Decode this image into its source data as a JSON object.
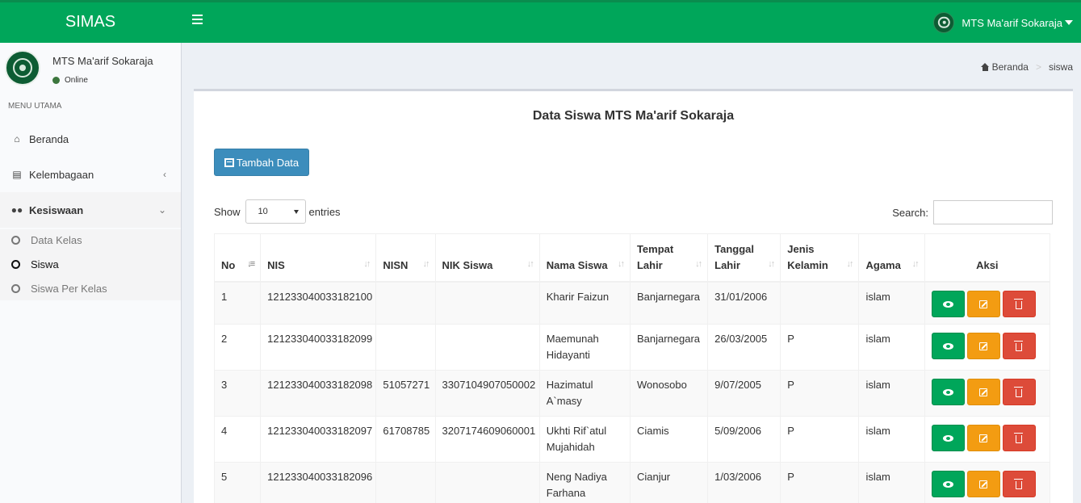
{
  "app": {
    "title": "SIMAS"
  },
  "header": {
    "user_name": "MTS Ma'arif Sokaraja"
  },
  "sidebar": {
    "user_name": "MTS Ma'arif Sokaraja",
    "status": "Online",
    "menu_header": "MENU UTAMA",
    "items": [
      {
        "label": "Beranda",
        "icon": "home-icon"
      },
      {
        "label": "Kelembagaan",
        "icon": "newspaper-icon"
      },
      {
        "label": "Kesiswaan",
        "icon": "users-icon",
        "expanded": true
      }
    ],
    "subitems": [
      {
        "label": "Data Kelas",
        "active": false
      },
      {
        "label": "Siswa",
        "active": true
      },
      {
        "label": "Siswa Per Kelas",
        "active": false
      }
    ]
  },
  "breadcrumb": {
    "home": "Beranda",
    "current": "siswa"
  },
  "main": {
    "title": "Data Siswa MTS Ma'arif Sokaraja",
    "add_button": "Tambah Data",
    "show_label": "Show",
    "entries_value": "10",
    "entries_label": "entries",
    "search_label": "Search:",
    "search_value": ""
  },
  "table": {
    "columns": [
      "No",
      "NIS",
      "NISN",
      "NIK Siswa",
      "Nama Siswa",
      "Tempat Lahir",
      "Tanggal Lahir",
      "Jenis Kelamin",
      "Agama",
      "Aksi"
    ],
    "rows": [
      {
        "no": "1",
        "nis": "121233040033182100",
        "nisn": "",
        "nik": "",
        "nama": "Kharir Faizun",
        "tempat": "Banjarnegara",
        "tanggal": "31/01/2006",
        "jk": "",
        "agama": "islam"
      },
      {
        "no": "2",
        "nis": "121233040033182099",
        "nisn": "",
        "nik": "",
        "nama": "Maemunah Hidayanti",
        "tempat": "Banjarnegara",
        "tanggal": "26/03/2005",
        "jk": "P",
        "agama": "islam"
      },
      {
        "no": "3",
        "nis": "121233040033182098",
        "nisn": "51057271",
        "nik": "3307104907050002",
        "nama": "Hazimatul A`masy",
        "tempat": "Wonosobo",
        "tanggal": "9/07/2005",
        "jk": "P",
        "agama": "islam"
      },
      {
        "no": "4",
        "nis": "121233040033182097",
        "nisn": "61708785",
        "nik": "3207174609060001",
        "nama": "Ukhti Rif`atul Mujahidah",
        "tempat": "Ciamis",
        "tanggal": "5/09/2006",
        "jk": "P",
        "agama": "islam"
      },
      {
        "no": "5",
        "nis": "121233040033182096",
        "nisn": "",
        "nik": "",
        "nama": "Neng Nadiya Farhana",
        "tempat": "Cianjur",
        "tanggal": "1/03/2006",
        "jk": "P",
        "agama": "islam"
      }
    ]
  },
  "colors": {
    "header_green": "#00a65a",
    "primary_blue": "#3c8dbc",
    "warning": "#f39c12",
    "danger": "#dd4b39"
  }
}
